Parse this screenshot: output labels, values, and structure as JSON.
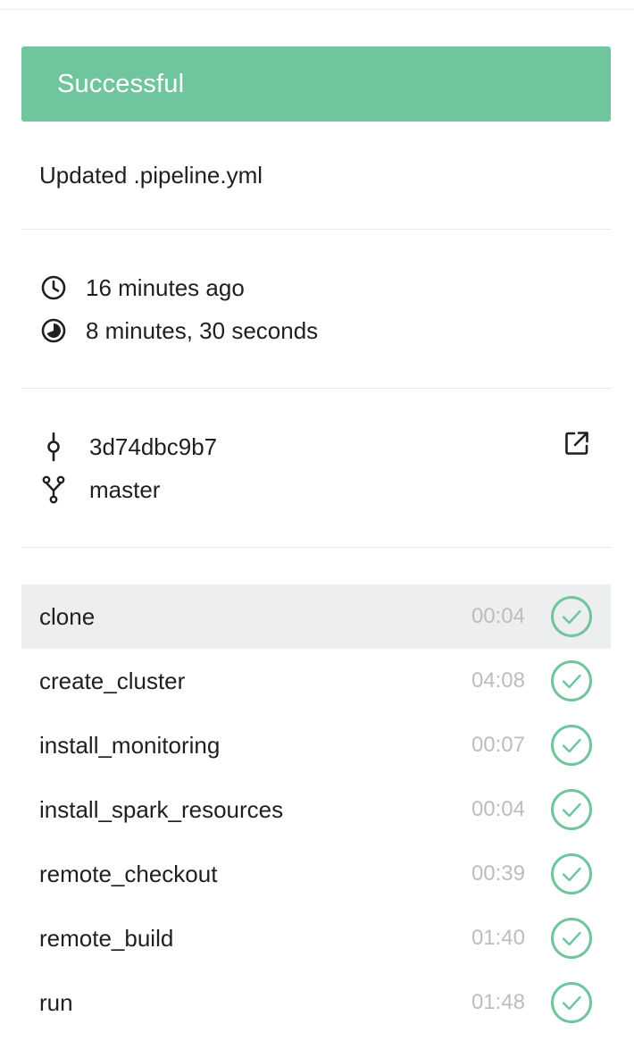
{
  "status": {
    "label": "Successful",
    "color": "#6fc59c"
  },
  "commit": {
    "message": "Updated .pipeline.yml"
  },
  "timing": {
    "started": "16 minutes ago",
    "duration": "8 minutes, 30 seconds",
    "started_icon": "clock-icon",
    "duration_icon": "timer-icon"
  },
  "source": {
    "commit_hash": "3d74dbc9b7",
    "branch": "master",
    "commit_icon": "commit-icon",
    "branch_icon": "branch-icon",
    "link_icon": "external-link-icon"
  },
  "steps": [
    {
      "name": "clone",
      "time": "00:04",
      "status": "success"
    },
    {
      "name": "create_cluster",
      "time": "04:08",
      "status": "success"
    },
    {
      "name": "install_monitoring",
      "time": "00:07",
      "status": "success"
    },
    {
      "name": "install_spark_resources",
      "time": "00:04",
      "status": "success"
    },
    {
      "name": "remote_checkout",
      "time": "00:39",
      "status": "success"
    },
    {
      "name": "remote_build",
      "time": "01:40",
      "status": "success"
    },
    {
      "name": "run",
      "time": "01:48",
      "status": "success"
    }
  ],
  "colors": {
    "success": "#6fc59c",
    "active_row": "#eceef0",
    "muted_text": "#bdbdbd"
  }
}
